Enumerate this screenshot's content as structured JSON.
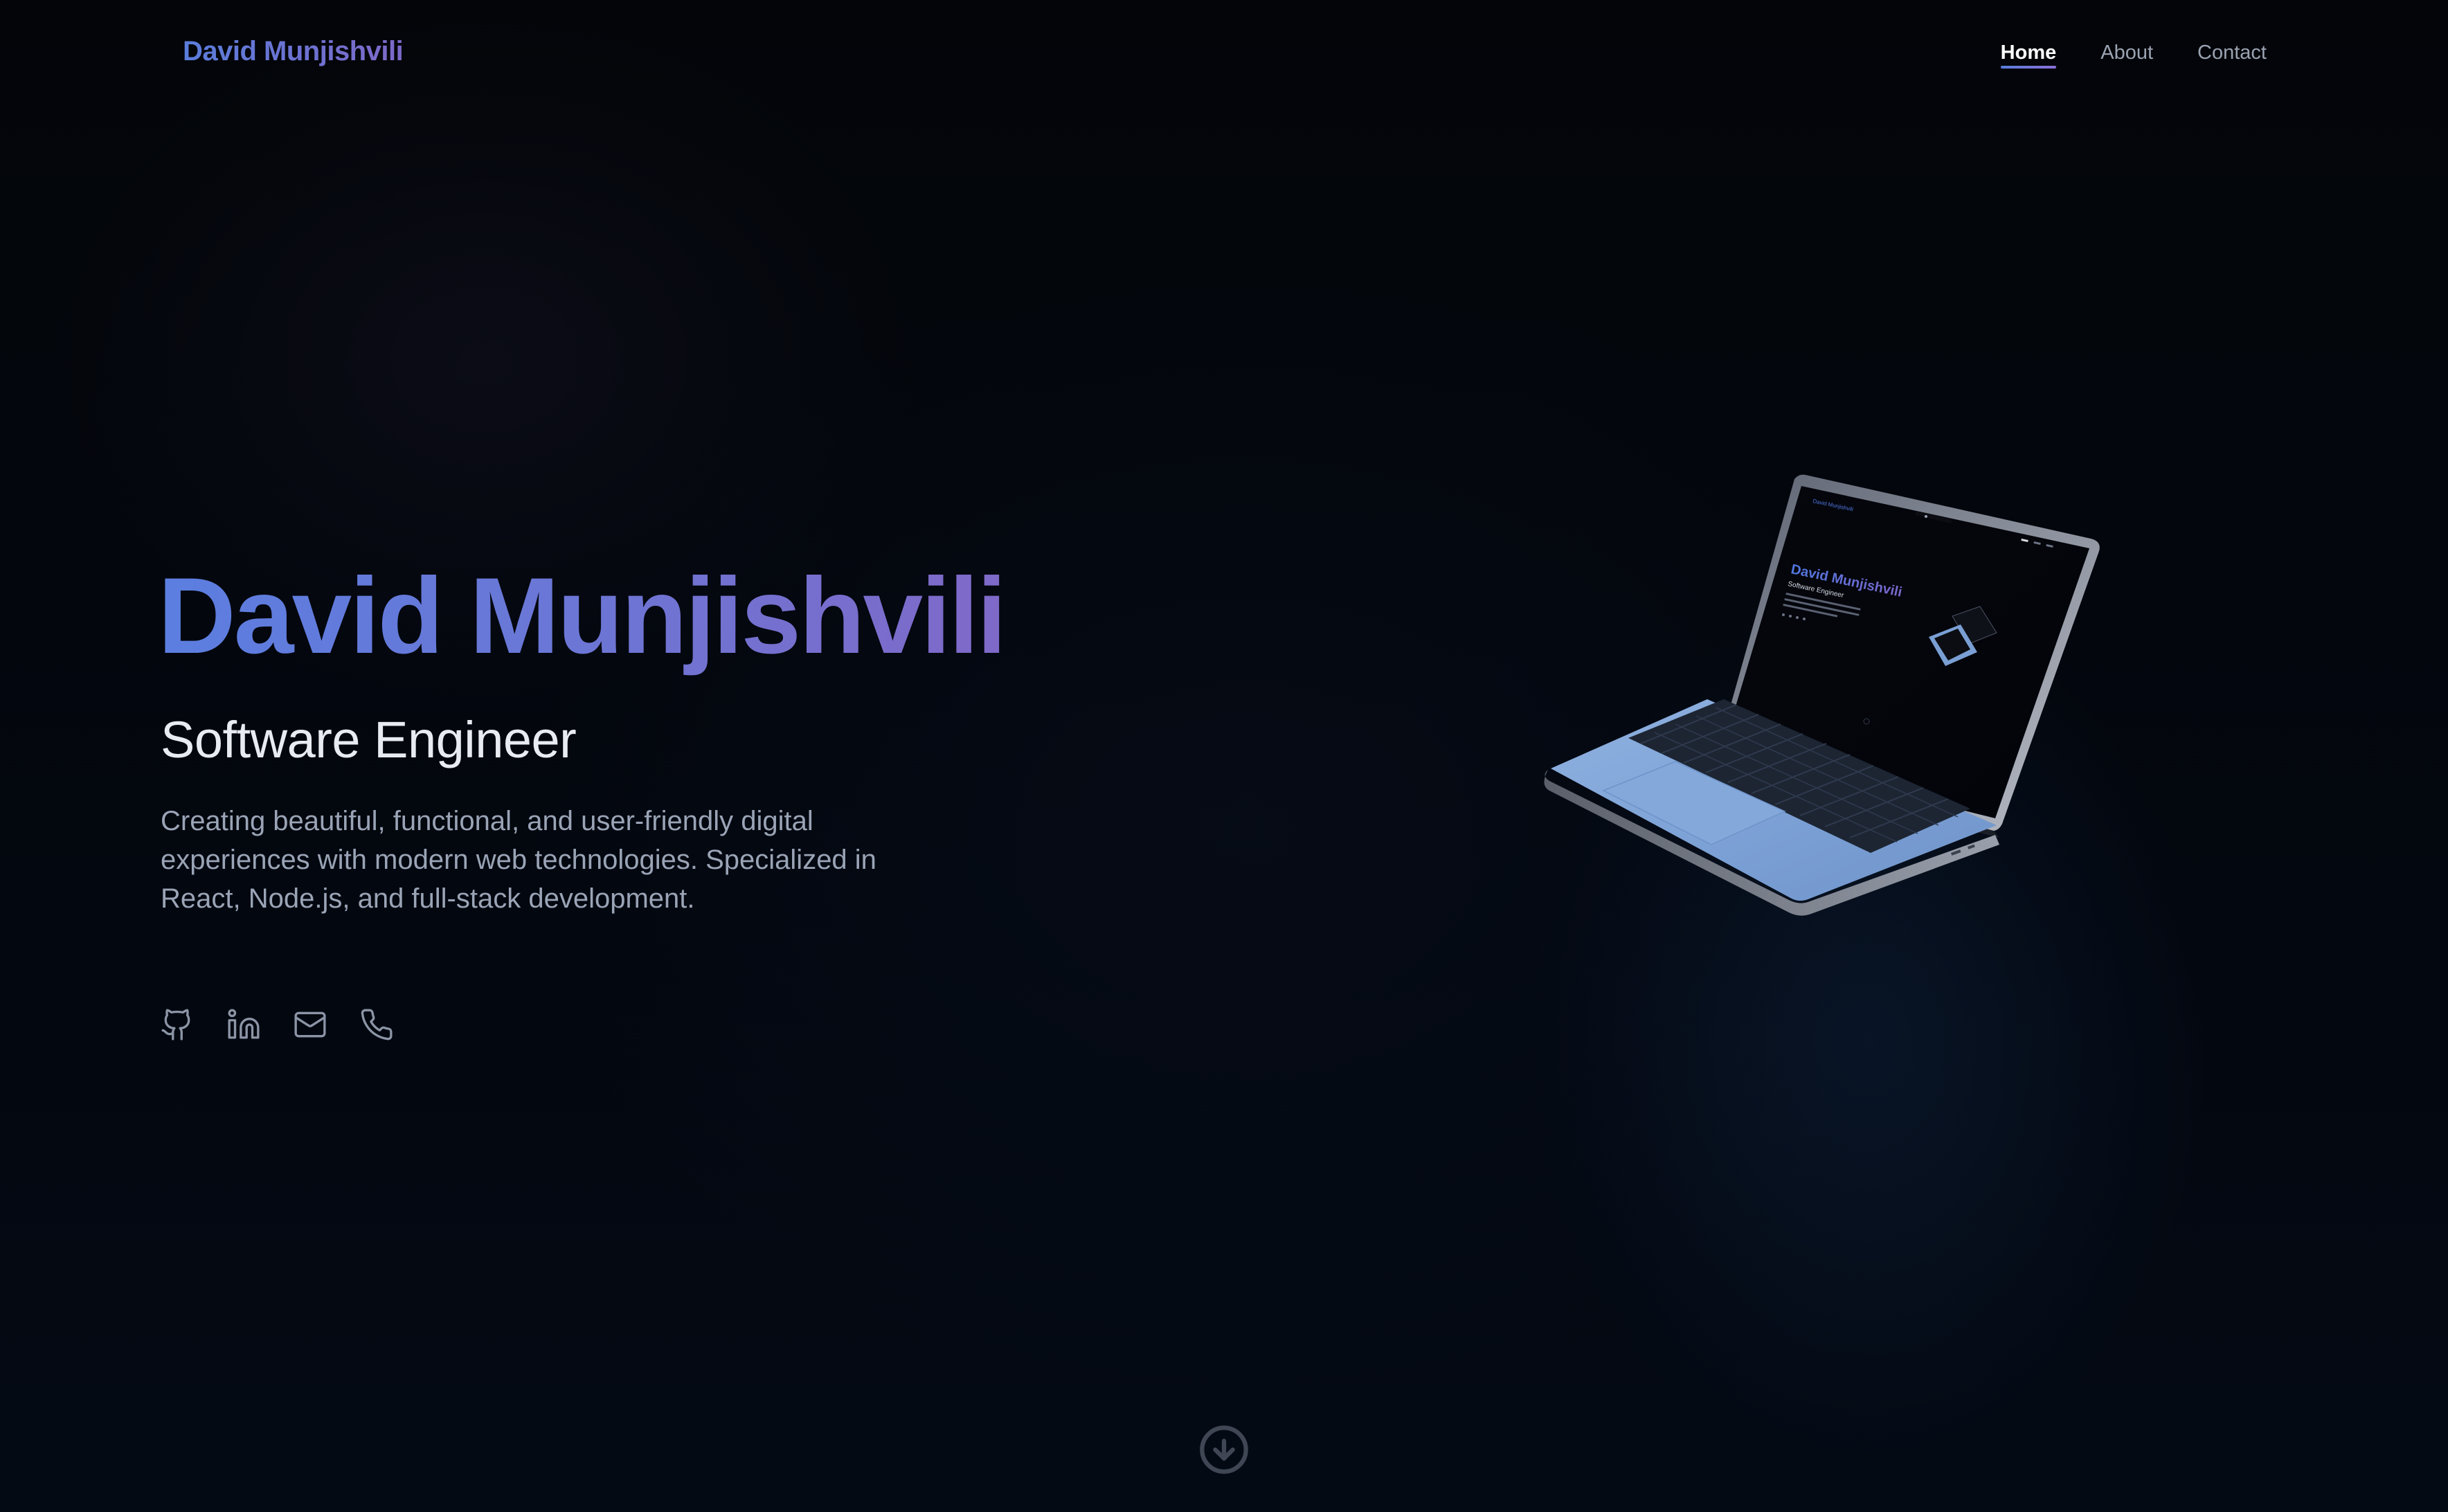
{
  "nav": {
    "brand": "David Munjishvili",
    "links": [
      {
        "label": "Home",
        "active": true
      },
      {
        "label": "About",
        "active": false
      },
      {
        "label": "Contact",
        "active": false
      }
    ]
  },
  "hero": {
    "title": "David Munjishvili",
    "subtitle": "Software Engineer",
    "description": "Creating beautiful, functional, and user-friendly digital experiences with modern web technologies. Specialized in React, Node.js, and full-stack development."
  },
  "socials": [
    {
      "icon": "github-icon"
    },
    {
      "icon": "linkedin-icon"
    },
    {
      "icon": "mail-icon"
    },
    {
      "icon": "phone-icon"
    }
  ],
  "laptop_screen": {
    "title": "David Munjishvili",
    "subtitle": "Software Engineer"
  },
  "scroll": {
    "icon": "arrow-down-circle-icon"
  },
  "colors": {
    "background": "#02060e",
    "gradient_start": "#5a7ddb",
    "gradient_end": "#7d69c9",
    "text_primary": "#e8ecf2",
    "text_secondary": "#9aa4b6",
    "laptop_body": "#7fa3d6"
  }
}
